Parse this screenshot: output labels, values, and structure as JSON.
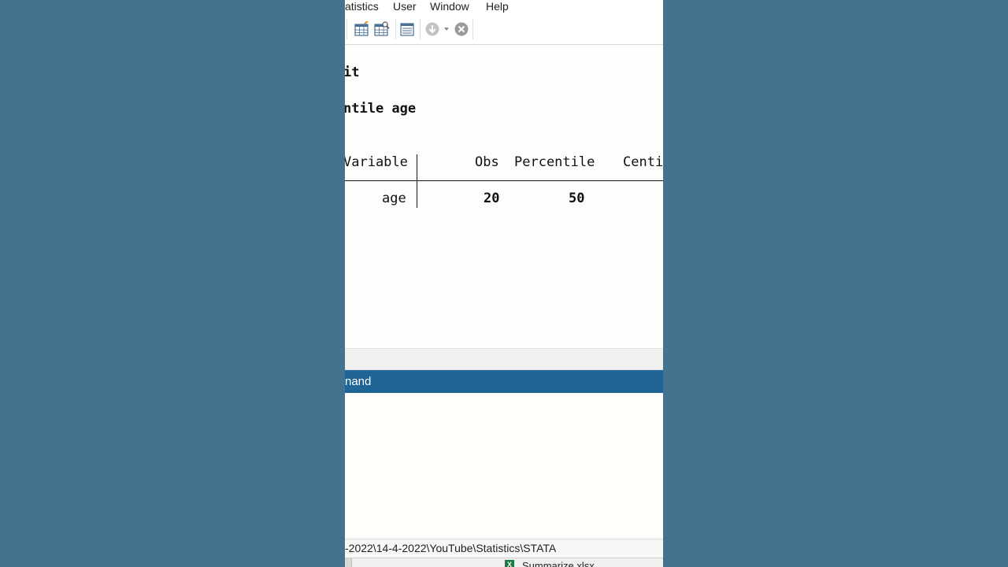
{
  "menu": {
    "items": [
      "atistics",
      "User",
      "Window",
      "Help"
    ]
  },
  "toolbar": {
    "icons": [
      "edit-grid-icon",
      "browse-grid-icon",
      "variables-manager-icon",
      "more-icon",
      "break-icon"
    ]
  },
  "results": {
    "line1": "it",
    "line2": "ntile age",
    "table": {
      "headers": [
        "Variable",
        "Obs",
        "Percentile",
        "Centi"
      ],
      "row": {
        "variable": "age",
        "obs": "20",
        "percentile": "50"
      }
    }
  },
  "command": {
    "title": "nand"
  },
  "status": {
    "path": "-2022\\14-4-2022\\YouTube\\Statistics\\STATA"
  },
  "taskbar": {
    "file": "Summarize.xlsx"
  },
  "colors": {
    "background": "#44738f",
    "command_header": "#1f6595"
  }
}
